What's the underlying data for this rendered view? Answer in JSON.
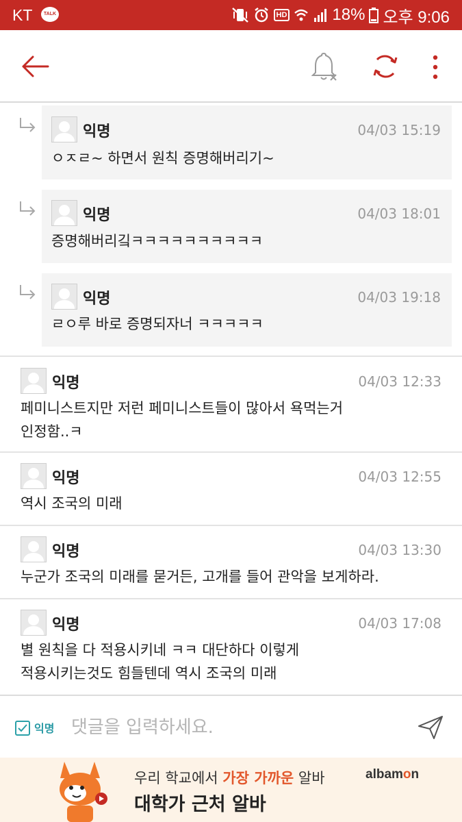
{
  "status_bar": {
    "carrier": "KT",
    "talk_badge": "TALK",
    "hd": "HD",
    "battery": "18%",
    "time": "오후 9:06",
    "bg_color": "#c42a24"
  },
  "toolbar": {
    "back_icon": "arrow-left-icon",
    "notification_icon": "bell-off-icon",
    "refresh_icon": "refresh-icon",
    "more_icon": "more-vertical-icon",
    "accent": "#c42a24"
  },
  "replies": [
    {
      "author": "익명",
      "time": "04/03 15:19",
      "text": "ㅇㅈㄹ~ 하면서 원칙 증명해버리기~"
    },
    {
      "author": "익명",
      "time": "04/03 18:01",
      "text": "증명해버리깈ㅋㅋㅋㅋㅋㅋㅋㅋㅋㅋ"
    },
    {
      "author": "익명",
      "time": "04/03 19:18",
      "text": "ㄹㅇ루 바로 증명되자너 ㅋㅋㅋㅋㅋ"
    }
  ],
  "comments": [
    {
      "author": "익명",
      "time": "04/03 12:33",
      "text_lines": [
        "페미니스트지만 저런 페미니스트들이 많아서 욕먹는거",
        "인정함..ㅋ"
      ]
    },
    {
      "author": "익명",
      "time": "04/03 12:55",
      "text_lines": [
        "역시 조국의 미래"
      ]
    },
    {
      "author": "익명",
      "time": "04/03 13:30",
      "text_lines": [
        "누군가 조국의 미래를 묻거든, 고개를 들어 관악을 보게하라."
      ]
    },
    {
      "author": "익명",
      "time": "04/03 17:08",
      "text_lines": [
        "별 원칙을 다 적용시키네 ㅋㅋ 대단하다 이렇게",
        "적용시키는것도 힘들텐데 역시 조국의 미래"
      ]
    }
  ],
  "input_bar": {
    "anonymous_label": "익명",
    "anonymous_checked": true,
    "placeholder": "댓글을 입력하세요.",
    "send_icon": "send-icon"
  },
  "ad": {
    "line1_prefix": "우리 학교에서 ",
    "line1_highlight": "가장 가까운",
    "line1_suffix": " 알바",
    "line2": "대학가 근처 알바",
    "logo_prefix": "albam",
    "logo_o": "o",
    "logo_suffix": "n",
    "mascot_icon": "fox-mascot-icon",
    "accent": "#e2572b"
  }
}
